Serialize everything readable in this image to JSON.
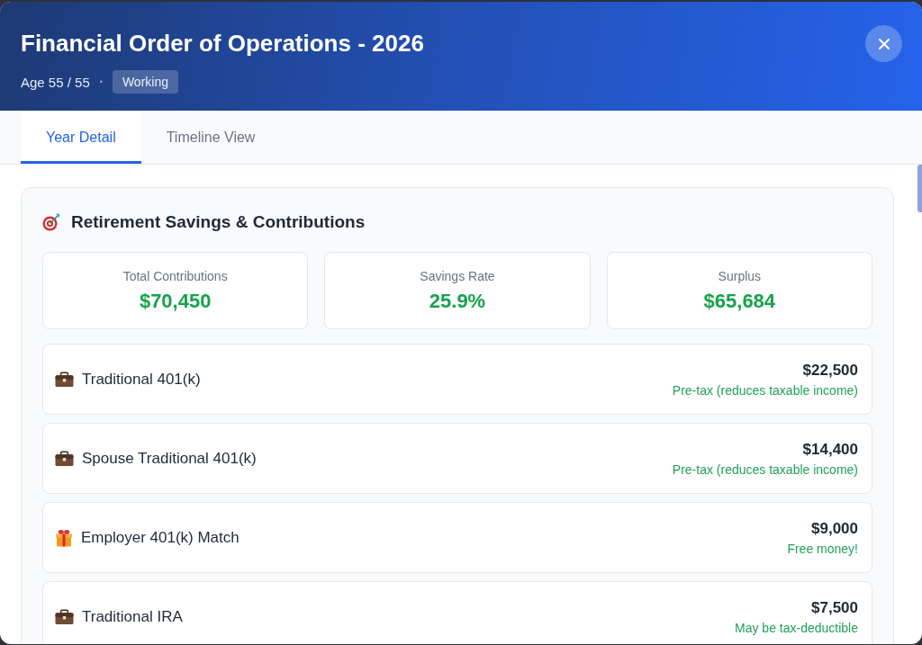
{
  "header": {
    "title": "Financial Order of Operations - 2026",
    "age": "Age 55 / 55",
    "separator": "•",
    "status_badge": "Working"
  },
  "tabs": [
    {
      "label": "Year Detail",
      "selected": true
    },
    {
      "label": "Timeline View",
      "selected": false
    }
  ],
  "section": {
    "title": "Retirement Savings & Contributions",
    "stats": [
      {
        "label": "Total Contributions",
        "value": "$70,450"
      },
      {
        "label": "Savings Rate",
        "value": "25.9%"
      },
      {
        "label": "Surplus",
        "value": "$65,684"
      }
    ],
    "contributions": [
      {
        "kind": "account",
        "name": "Traditional 401(k)",
        "amount": "$22,500",
        "note": "Pre-tax (reduces taxable income)"
      },
      {
        "kind": "account",
        "name": "Spouse Traditional 401(k)",
        "amount": "$14,400",
        "note": "Pre-tax (reduces taxable income)"
      },
      {
        "kind": "match",
        "name": "Employer 401(k) Match",
        "amount": "$9,000",
        "note": "Free money!"
      },
      {
        "kind": "account",
        "name": "Traditional IRA",
        "amount": "$7,500",
        "note": "May be tax-deductible"
      }
    ]
  }
}
